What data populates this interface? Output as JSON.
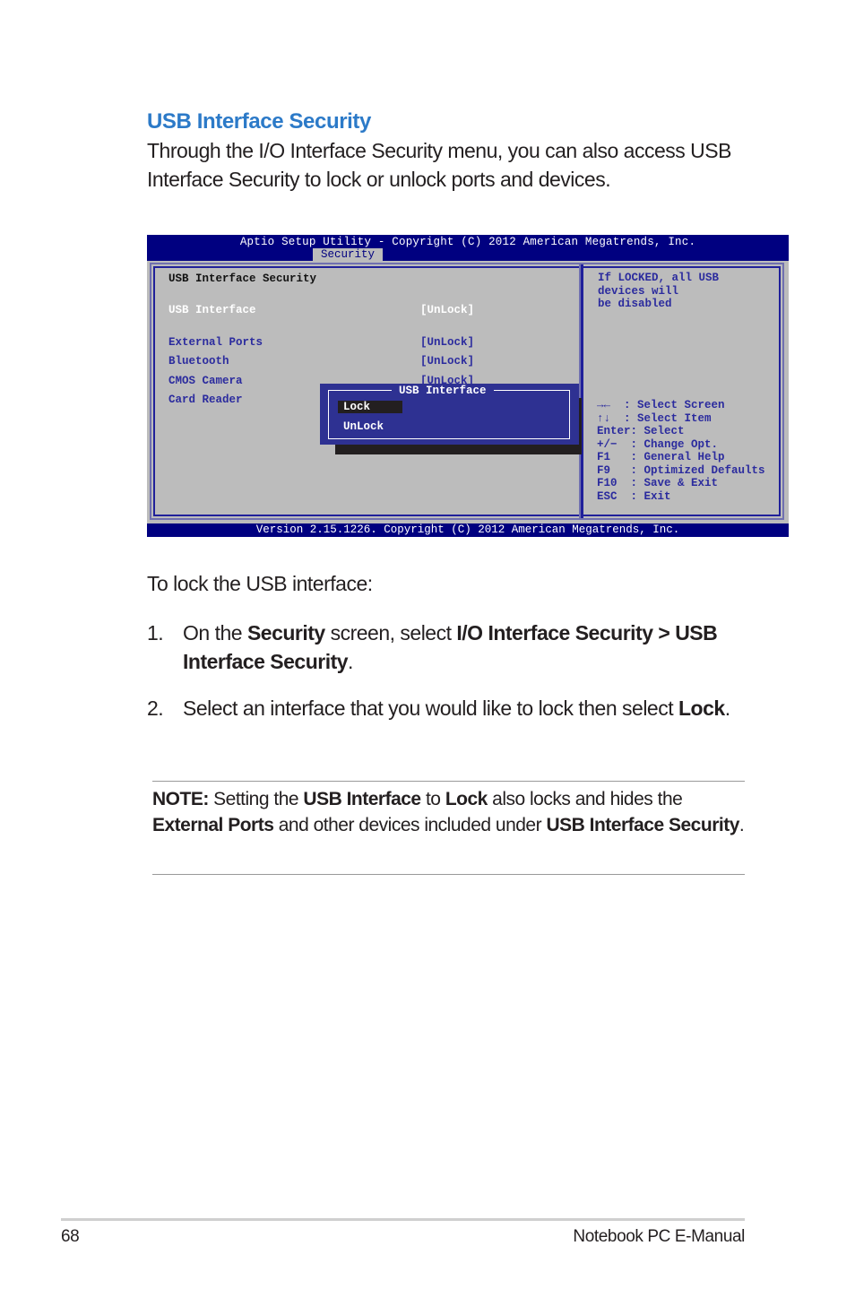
{
  "section": {
    "title": "USB Interface Security",
    "intro": "Through the I/O Interface Security menu, you can also access USB Interface Security to lock or unlock ports and devices."
  },
  "bios": {
    "title": "Aptio Setup Utility - Copyright (C) 2012 American Megatrends, Inc.",
    "active_tab": "Security",
    "footer": "Version 2.15.1226. Copyright (C) 2012 American Megatrends, Inc.",
    "colors": {
      "header_bg": "#000080",
      "panel_bg": "#bcbcbc",
      "item_text": "#2b2b9e",
      "popup_bg": "#2e3192"
    },
    "heading": "USB Interface Security",
    "items": [
      {
        "label": "USB Interface",
        "value": "[UnLock]",
        "selected": true
      },
      {
        "label": "External Ports",
        "value": "[UnLock]"
      },
      {
        "label": "Bluetooth",
        "value": "[UnLock]"
      },
      {
        "label": "CMOS Camera",
        "value": "[UnLock]"
      },
      {
        "label": "Card Reader",
        "value": ""
      }
    ],
    "help_lines": [
      "If LOCKED, all USB",
      "devices will",
      "be disabled"
    ],
    "keys": [
      {
        "key": "→←",
        "sep": "  : ",
        "action": "Select Screen"
      },
      {
        "key": "↑↓",
        "sep": "  : ",
        "action": "Select Item"
      },
      {
        "key": "Enter",
        "sep": ": ",
        "action": "Select"
      },
      {
        "key": "+/−",
        "sep": "  : ",
        "action": "Change Opt."
      },
      {
        "key": "F1",
        "sep": "   : ",
        "action": "General Help"
      },
      {
        "key": "F9",
        "sep": "   : ",
        "action": "Optimized Defaults"
      },
      {
        "key": "F10",
        "sep": "  : ",
        "action": "Save & Exit"
      },
      {
        "key": "ESC",
        "sep": "  : ",
        "action": "Exit"
      }
    ],
    "popup": {
      "title": "USB Interface",
      "options": [
        {
          "label": "Lock",
          "highlighted": true
        },
        {
          "label": "UnLock",
          "highlighted": false
        }
      ]
    }
  },
  "instructions": {
    "lead": "To lock the USB interface:",
    "steps": [
      {
        "number": "1.",
        "parts": [
          "On the ",
          "Security",
          " screen, select ",
          "I/O Interface Security > USB Interface Security",
          "."
        ]
      },
      {
        "number": "2.",
        "parts": [
          "Select an interface that you would like to lock then select ",
          "Lock",
          "."
        ]
      }
    ]
  },
  "note": {
    "parts": [
      "NOTE:",
      " Setting the ",
      "USB Interface",
      " to ",
      "Lock",
      " also locks and hides the ",
      "External Ports",
      " and other devices included under ",
      "USB Interface Security",
      "."
    ]
  },
  "footer": {
    "page_number": "68",
    "manual_title": "Notebook PC E-Manual"
  }
}
